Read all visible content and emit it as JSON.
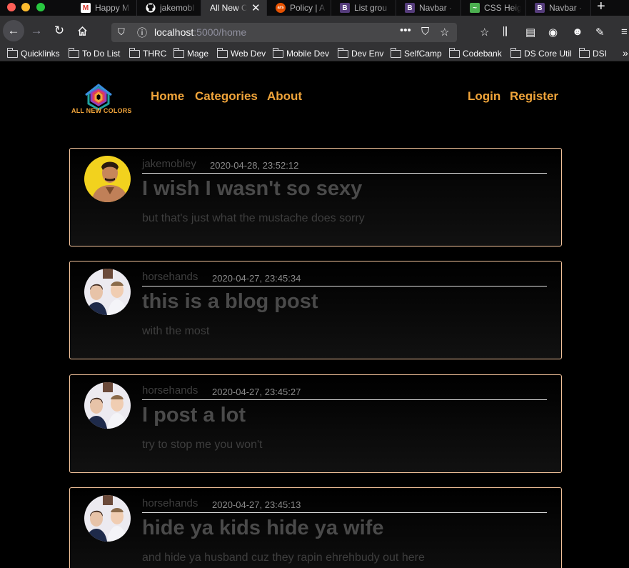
{
  "browser": {
    "tabs": [
      {
        "label": "Happy M",
        "favicon": "gmail-icon",
        "color": "#d93025",
        "glyph": "M"
      },
      {
        "label": "jakemobl",
        "favicon": "github-icon",
        "color": "#ffffff",
        "glyph": ""
      },
      {
        "label": "All New C",
        "favicon": "none",
        "color": "",
        "glyph": "",
        "active": true
      },
      {
        "label": "Policy | A",
        "favicon": "ars-icon",
        "color": "#e65100",
        "glyph": "ars"
      },
      {
        "label": "List grou",
        "favicon": "bootstrap-icon",
        "color": "#563d7c",
        "glyph": "B"
      },
      {
        "label": "Navbar ·",
        "favicon": "bootstrap-icon",
        "color": "#563d7c",
        "glyph": "B"
      },
      {
        "label": "CSS Heig",
        "favicon": "chart-icon",
        "color": "#4caf50",
        "glyph": "~"
      },
      {
        "label": "Navbar ·",
        "favicon": "bootstrap-icon",
        "color": "#563d7c",
        "glyph": "B"
      }
    ],
    "url_host": "localhost",
    "url_path": ":5000/home",
    "bookmarks": [
      "Quicklinks",
      "To Do List",
      "THRC",
      "Mage",
      "Web Dev",
      "Mobile Dev",
      "Dev Env",
      "SelfCamp",
      "Codebank",
      "DS Core Util",
      "DSI"
    ],
    "bookmarks_overflow": "»"
  },
  "site": {
    "logo_text": "ALL NEW COLORS",
    "nav": [
      "Home",
      "Categories",
      "About"
    ],
    "auth": [
      "Login",
      "Register"
    ],
    "accent": "#f0a43a"
  },
  "posts": [
    {
      "author": "jakemobley",
      "date": "2020-04-28, 23:52:12",
      "title": "I wish I wasn't so sexy",
      "body": "but that's just what the mustache does sorry",
      "avatar": "mustache-man"
    },
    {
      "author": "horsehands",
      "date": "2020-04-27, 23:45:34",
      "title": "this is a blog post",
      "body": "with the most",
      "avatar": "two-men"
    },
    {
      "author": "horsehands",
      "date": "2020-04-27, 23:45:27",
      "title": "I post a lot",
      "body": "try to stop me you won't",
      "avatar": "two-men"
    },
    {
      "author": "horsehands",
      "date": "2020-04-27, 23:45:13",
      "title": "hide ya kids hide ya wife",
      "body": "and hide ya husband cuz they rapin ehrehbudy out here",
      "avatar": "two-men"
    }
  ]
}
